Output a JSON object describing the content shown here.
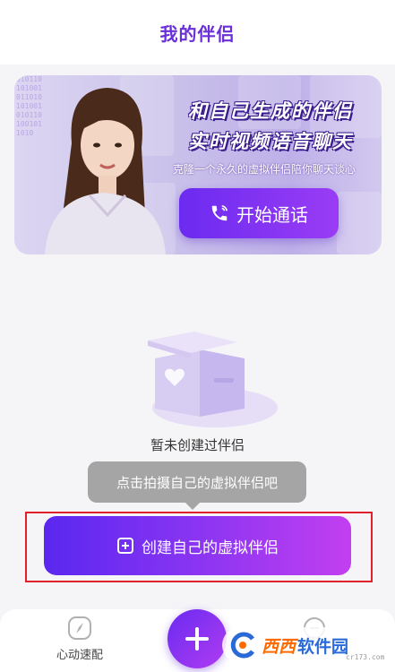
{
  "header": {
    "title": "我的伴侣"
  },
  "banner": {
    "headline_line1": "和自己生成的伴侣",
    "headline_line2": "实时视频语音聊天",
    "subtitle": "克隆一个永久的虚拟伴侣陪你聊天谈心",
    "call_button_label": "开始通话",
    "call_icon": "phone-icon",
    "code_text": "0101101010010110101010010101101001011010"
  },
  "empty_state": {
    "text": "暂未创建过伴侣",
    "icon": "empty-box-icon"
  },
  "tooltip": {
    "text": "点击拍摄自己的虚拟伴侣吧"
  },
  "create_button": {
    "label": "创建自己的虚拟伴侣",
    "icon": "plus-square-icon"
  },
  "tabbar": {
    "left": {
      "label": "心动速配",
      "icon": "compass-icon"
    },
    "center": {
      "icon": "plus-icon"
    },
    "right": {
      "label": "",
      "icon": "minus-circle-icon"
    }
  },
  "watermark": {
    "brand1": "西西",
    "brand2": "软件园",
    "url": "cr173.com"
  },
  "colors": {
    "accent": "#6a2fd8",
    "button_gradient_start": "#5a27f0",
    "button_gradient_end": "#c23ff0",
    "highlight_frame": "#e0202a",
    "tooltip_bg": "#a5a5a5"
  }
}
